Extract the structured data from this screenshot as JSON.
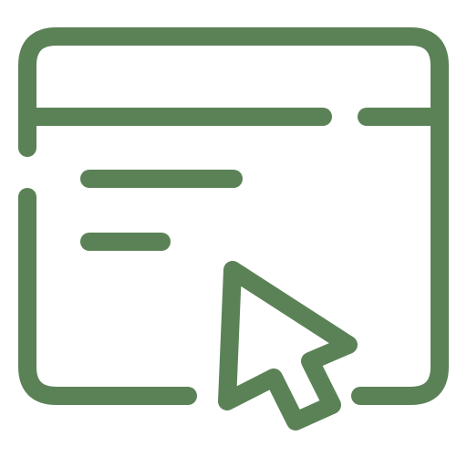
{
  "icon": {
    "name": "browser-window-cursor-icon",
    "color": "#5b8257"
  }
}
